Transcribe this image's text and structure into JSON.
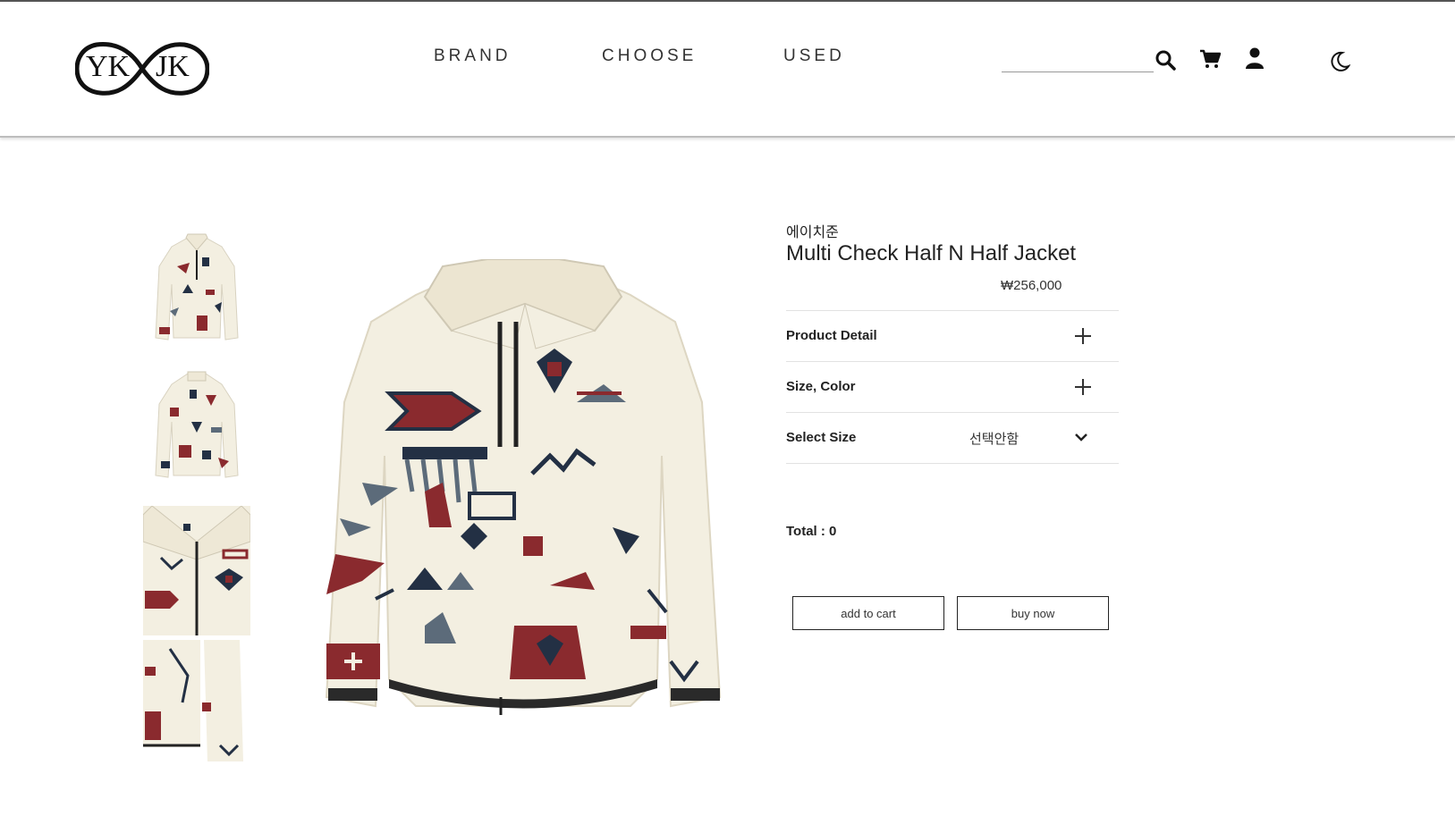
{
  "logo": {
    "left_text": "YK",
    "right_text": "JK"
  },
  "nav": {
    "items": [
      "BRAND",
      "CHOOSE",
      "USED"
    ]
  },
  "search": {
    "value": "",
    "placeholder": ""
  },
  "icons": {
    "search": "search-icon",
    "cart": "cart-icon",
    "user": "user-icon",
    "theme": "moon-icon"
  },
  "product": {
    "brand": "에이치준",
    "title": "Multi Check Half N Half Jacket",
    "price": "₩256,000",
    "thumbnails": [
      "thumbnail-front",
      "thumbnail-back",
      "thumbnail-collar-detail",
      "thumbnail-sleeve-detail"
    ]
  },
  "options": {
    "product_detail_label": "Product Detail",
    "size_color_label": "Size, Color",
    "select_size_label": "Select Size",
    "select_size_value": "선택안함"
  },
  "total": {
    "label": "Total : 0"
  },
  "buttons": {
    "add_to_cart": "add to cart",
    "buy_now": "buy now"
  },
  "colors": {
    "fleece": "#f3efe1",
    "maroon": "#8a2a2e",
    "navy": "#233044",
    "slate": "#5c6b7a",
    "header_border": "#bdbdbd"
  }
}
